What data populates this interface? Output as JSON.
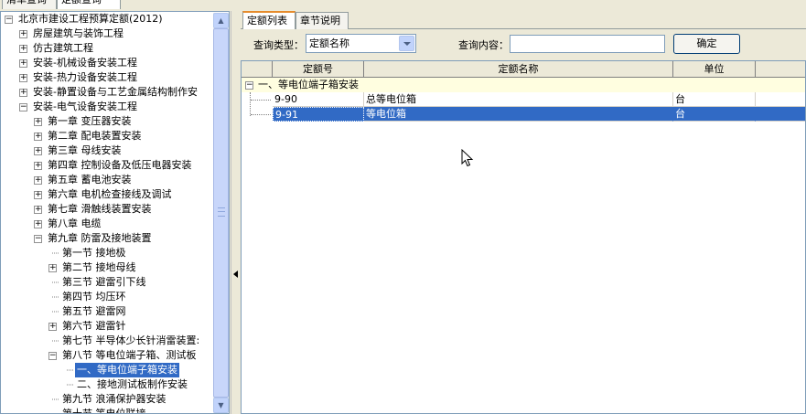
{
  "top_tabs": [
    "清单查询",
    "定额查询"
  ],
  "tree": {
    "items": [
      {
        "label": "北京市建设工程预算定额(2012)",
        "expander": "−",
        "level": 0
      },
      {
        "label": "房屋建筑与装饰工程",
        "expander": "+",
        "level": 1
      },
      {
        "label": "仿古建筑工程",
        "expander": "+",
        "level": 1
      },
      {
        "label": "安装-机械设备安装工程",
        "expander": "+",
        "level": 1
      },
      {
        "label": "安装-热力设备安装工程",
        "expander": "+",
        "level": 1
      },
      {
        "label": "安装-静置设备与工艺金属结构制作安",
        "expander": "+",
        "level": 1
      },
      {
        "label": "安装-电气设备安装工程",
        "expander": "−",
        "level": 1
      },
      {
        "label": "第一章 变压器安装",
        "expander": "+",
        "level": 2
      },
      {
        "label": "第二章 配电装置安装",
        "expander": "+",
        "level": 2
      },
      {
        "label": "第三章 母线安装",
        "expander": "+",
        "level": 2
      },
      {
        "label": "第四章 控制设备及低压电器安装",
        "expander": "+",
        "level": 2
      },
      {
        "label": "第五章 蓄电池安装",
        "expander": "+",
        "level": 2
      },
      {
        "label": "第六章 电机检查接线及调试",
        "expander": "+",
        "level": 2
      },
      {
        "label": "第七章 滑触线装置安装",
        "expander": "+",
        "level": 2
      },
      {
        "label": "第八章 电缆",
        "expander": "+",
        "level": 2
      },
      {
        "label": "第九章 防雷及接地装置",
        "expander": "−",
        "level": 2
      },
      {
        "label": "第一节 接地极",
        "expander": "",
        "level": 3
      },
      {
        "label": "第二节 接地母线",
        "expander": "+",
        "level": 3
      },
      {
        "label": "第三节 避雷引下线",
        "expander": "",
        "level": 3
      },
      {
        "label": "第四节 均压环",
        "expander": "",
        "level": 3
      },
      {
        "label": "第五节 避雷网",
        "expander": "",
        "level": 3
      },
      {
        "label": "第六节 避雷针",
        "expander": "+",
        "level": 3
      },
      {
        "label": "第七节 半导体少长针消雷装置:",
        "expander": "",
        "level": 3
      },
      {
        "label": "第八节 等电位端子箱、测试板",
        "expander": "−",
        "level": 3
      },
      {
        "label": "一、等电位端子箱安装",
        "expander": "",
        "level": 4,
        "selected": true
      },
      {
        "label": "二、接地测试板制作安装",
        "expander": "",
        "level": 4
      },
      {
        "label": "第九节 浪涌保护器安装",
        "expander": "",
        "level": 3
      },
      {
        "label": "第十节 等电位联接",
        "expander": "",
        "level": 3
      }
    ]
  },
  "right": {
    "tabs": [
      "定额列表",
      "章节说明"
    ],
    "query_type_label": "查询类型：",
    "query_type_value": "定额名称",
    "query_content_label": "查询内容：",
    "query_content_value": "",
    "confirm_label": "确定",
    "columns": [
      "定额号",
      "定额名称",
      "单位"
    ],
    "group_label": "一、等电位端子箱安装",
    "rows": [
      {
        "code": "9-90",
        "name": "总等电位箱",
        "unit": "台",
        "selected": false
      },
      {
        "code": "9-91",
        "name": "等电位箱",
        "unit": "台",
        "selected": true
      }
    ]
  },
  "colors": {
    "selection": "#316ac5",
    "group_row_bg": "#fffee0",
    "active_tab_accent": "#e68b2c"
  },
  "icons": [
    "expand-icon",
    "collapse-icon",
    "dropdown-arrow-icon",
    "scroll-up-icon",
    "scroll-down-icon",
    "splitter-arrow-icon",
    "mouse-cursor-icon"
  ]
}
